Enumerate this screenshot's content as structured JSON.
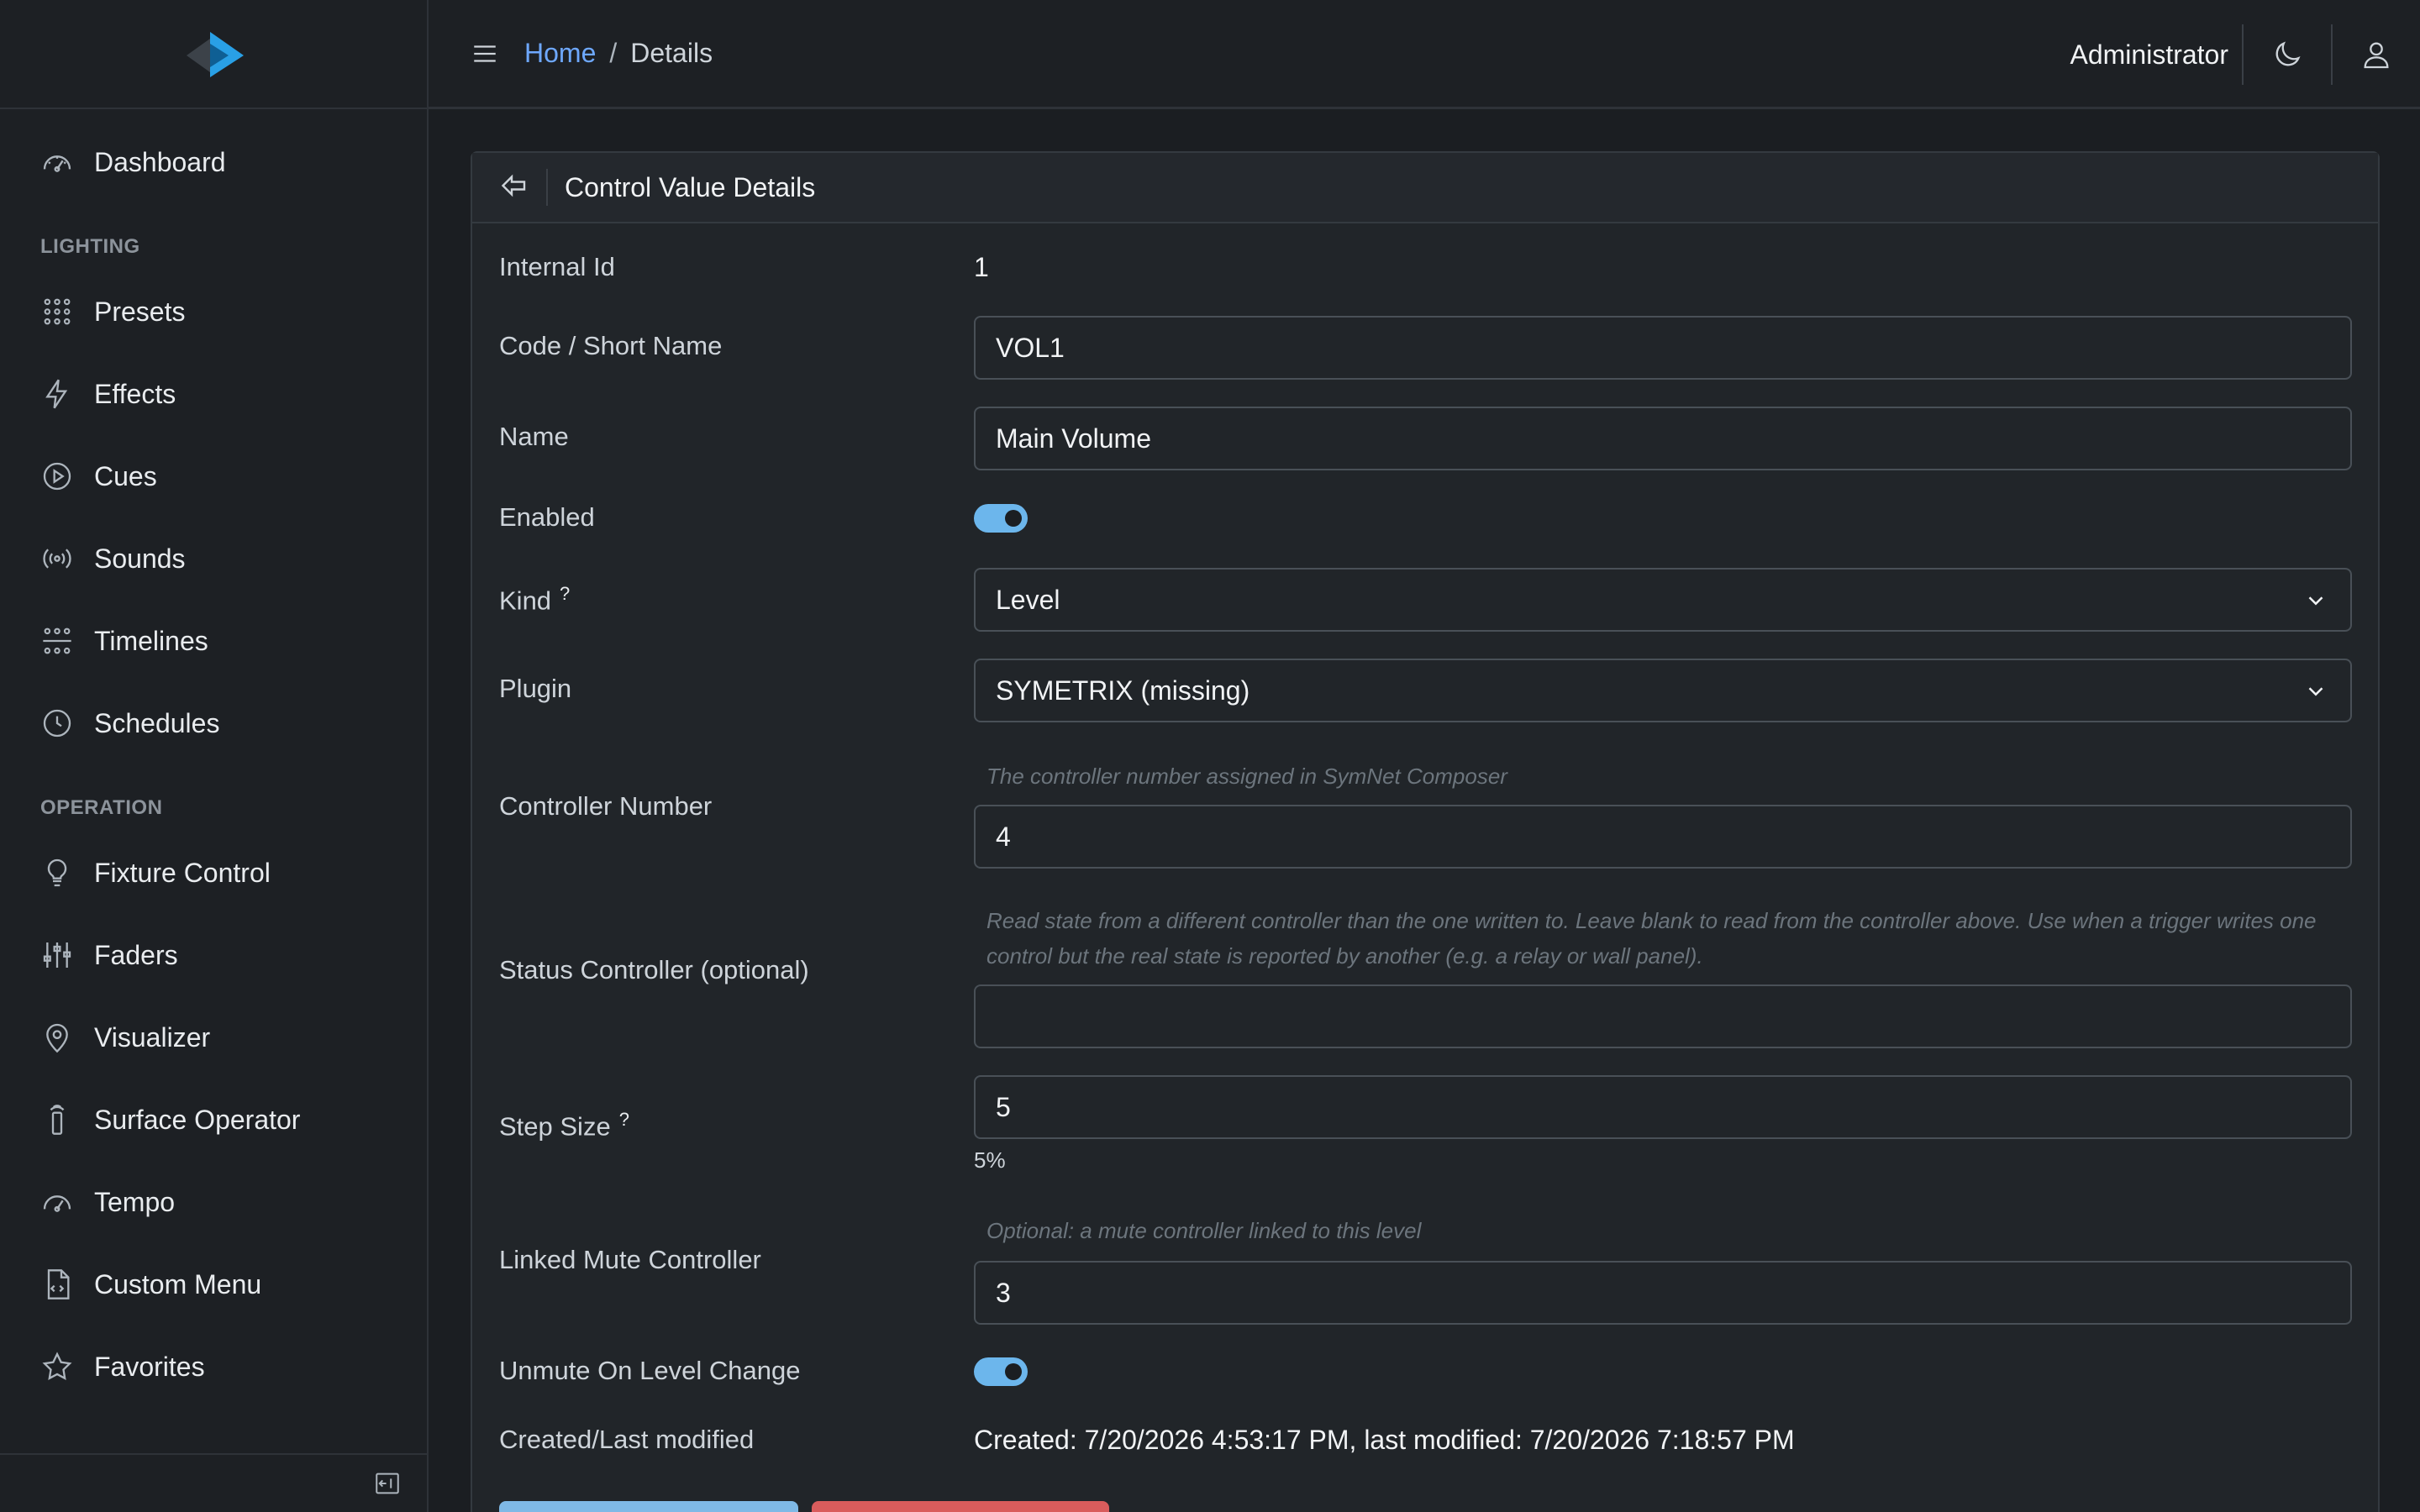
{
  "header": {
    "breadcrumb_home": "Home",
    "breadcrumb_sep": "/",
    "breadcrumb_current": "Details",
    "user_name": "Administrator"
  },
  "sidebar": {
    "dashboard": "Dashboard",
    "section_lighting": "LIGHTING",
    "lighting_items": [
      {
        "label": "Presets",
        "icon": "grid-dots-icon"
      },
      {
        "label": "Effects",
        "icon": "lightning-icon"
      },
      {
        "label": "Cues",
        "icon": "play-circle-icon"
      },
      {
        "label": "Sounds",
        "icon": "broadcast-icon"
      },
      {
        "label": "Timelines",
        "icon": "timeline-icon"
      },
      {
        "label": "Schedules",
        "icon": "clock-icon"
      }
    ],
    "section_operation": "OPERATION",
    "operation_items": [
      {
        "label": "Fixture Control",
        "icon": "lightbulb-icon"
      },
      {
        "label": "Faders",
        "icon": "sliders-icon"
      },
      {
        "label": "Visualizer",
        "icon": "map-pin-icon"
      },
      {
        "label": "Surface Operator",
        "icon": "remote-icon"
      },
      {
        "label": "Tempo",
        "icon": "speedometer-icon"
      },
      {
        "label": "Custom Menu",
        "icon": "code-file-icon"
      },
      {
        "label": "Favorites",
        "icon": "star-icon"
      }
    ]
  },
  "card": {
    "title": "Control Value Details"
  },
  "form": {
    "internal_id_label": "Internal Id",
    "internal_id_value": "1",
    "code_label": "Code / Short Name",
    "code_value": "VOL1",
    "name_label": "Name",
    "name_value": "Main Volume",
    "enabled_label": "Enabled",
    "enabled": true,
    "kind_label": "Kind",
    "kind_help": "?",
    "kind_value": "Level",
    "plugin_label": "Plugin",
    "plugin_value": "SYMETRIX (missing)",
    "controller_number_label": "Controller Number",
    "controller_number_hint": "The controller number assigned in SymNet Composer",
    "controller_number_value": "4",
    "status_controller_label": "Status Controller (optional)",
    "status_controller_hint": "Read state from a different controller than the one written to. Leave blank to read from the controller above. Use when a trigger writes one control but the real state is reported by another (e.g. a relay or wall panel).",
    "status_controller_value": "",
    "step_size_label": "Step Size",
    "step_size_help": "?",
    "step_size_value": "5",
    "step_size_percent": "5%",
    "linked_mute_label": "Linked Mute Controller",
    "linked_mute_hint": "Optional: a mute controller linked to this level",
    "linked_mute_value": "3",
    "unmute_label": "Unmute On Level Change",
    "unmute_enabled": true,
    "created_label": "Created/Last modified",
    "created_value": "Created: 7/20/2026 4:53:17 PM, last modified: 7/20/2026 7:18:57 PM"
  },
  "colors": {
    "accent": "#6cb6ec",
    "link": "#6ea8fe",
    "danger": "#d95c5c",
    "background": "#1b1e22"
  }
}
